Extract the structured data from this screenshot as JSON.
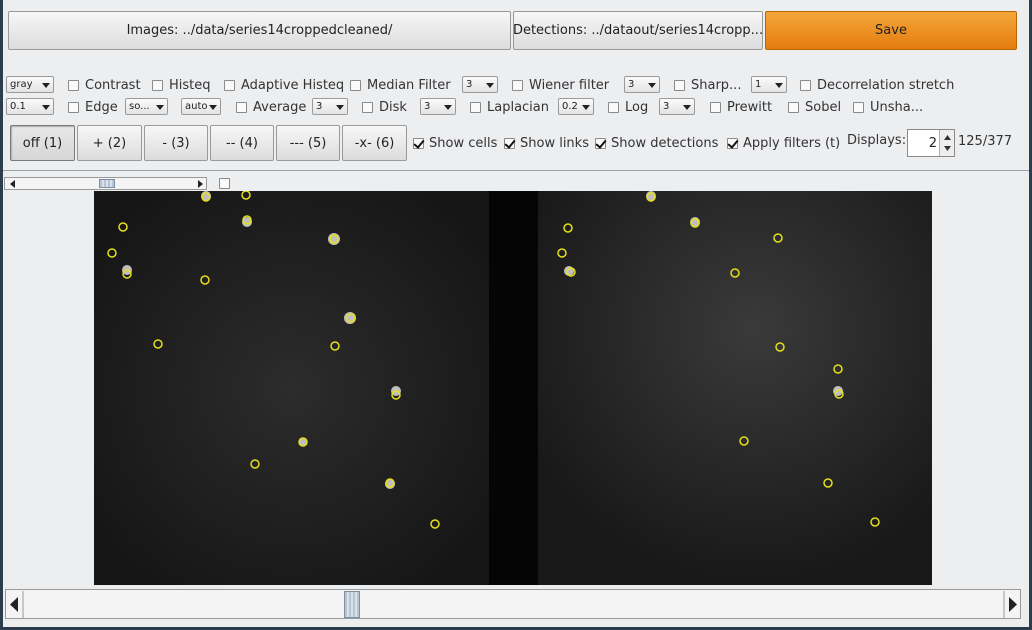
{
  "top_buttons": {
    "images_label": "Images: ../data/series14croppedcleaned/",
    "detections_label": "Detections: ../dataout/series14cropp...",
    "save_label": "Save"
  },
  "filters_row1": {
    "colormap_value": "gray",
    "contrast_label": "Contrast",
    "histeq_label": "Histeq",
    "adaptive_histeq_label": "Adaptive Histeq",
    "median_filter_label": "Median Filter",
    "median_size_value": "3",
    "wiener_filter_label": "Wiener filter",
    "wiener_size_value": "3",
    "sharp_label": "Sharp...",
    "sharp_value": "1",
    "decorrelation_label": "Decorrelation stretch"
  },
  "filters_row2": {
    "edge_threshold_value": "0.1",
    "edge_label": "Edge",
    "edge_method_value": "so...",
    "edge_mode_value": "auto",
    "average_label": "Average",
    "average_size_value": "3",
    "disk_label": "Disk",
    "disk_size_value": "3",
    "laplacian_label": "Laplacian",
    "laplacian_value": "0.2",
    "log_label": "Log",
    "log_size_value": "3",
    "prewitt_label": "Prewitt",
    "sobel_label": "Sobel",
    "unsharp_label": "Unsha..."
  },
  "toolbar": {
    "off_label": "off (1)",
    "plus_label": "+ (2)",
    "minus_label": "- (3)",
    "minus2_label": "-- (4)",
    "minus3_label": "--- (5)",
    "x_label": "-x- (6)",
    "show_cells_label": "Show cells",
    "show_links_label": "Show links",
    "show_detections_label": "Show detections",
    "apply_filters_label": "Apply filters (t)",
    "displays_label": "Displays:",
    "displays_value": "2",
    "frame_counter": "125/377"
  },
  "state": {
    "show_cells": true,
    "show_links": true,
    "show_detections": true,
    "apply_filters": true,
    "frame_progress": 0.332
  },
  "colors": {
    "save_accent": "#e88510",
    "detection_marker": "#e6e01a"
  },
  "icons": [
    "scroll-left-arrow-icon",
    "scroll-right-arrow-icon",
    "spinner-up-icon",
    "spinner-down-icon",
    "dropdown-arrow-icon"
  ]
}
